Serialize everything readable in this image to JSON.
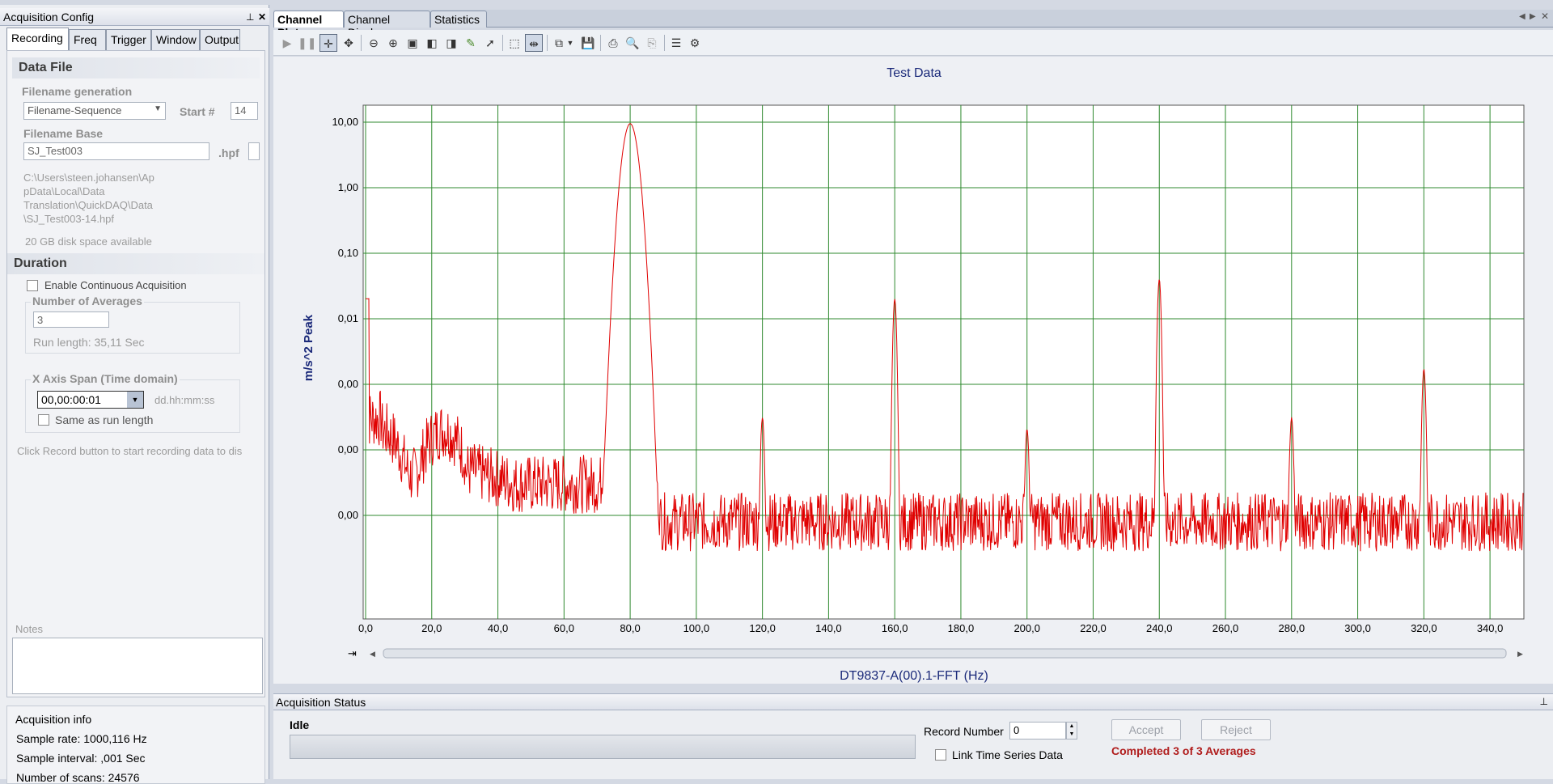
{
  "left_panel": {
    "title": "Acquisition Config",
    "pin_icon": "pin-icon",
    "close_icon": "close-icon",
    "tabs": [
      {
        "label": "Recording",
        "active": true
      },
      {
        "label": "Freq",
        "active": false
      },
      {
        "label": "Trigger",
        "active": false
      },
      {
        "label": "Window",
        "active": false
      },
      {
        "label": "Output",
        "active": false
      }
    ],
    "data_file": {
      "header": "Data File",
      "filename_generation_label": "Filename generation",
      "filename_generation_value": "Filename-Sequence",
      "start_label": "Start #",
      "start_value": "14",
      "filename_base_label": "Filename Base",
      "filename_base_value": "SJ_Test003",
      "extension": ".hpf",
      "path_lines": [
        "C:\\Users\\steen.johansen\\Ap",
        "pData\\Local\\Data",
        "Translation\\QuickDAQ\\Data",
        "\\SJ_Test003-14.hpf"
      ],
      "disk_space": "20 GB disk space available"
    },
    "duration": {
      "header": "Duration",
      "continuous_label": "Enable Continuous Acquisition",
      "averages_group": "Number of Averages",
      "averages_value": "3",
      "run_length": "Run length: 35,11 Sec",
      "span_group": "X Axis Span (Time domain)",
      "span_value": "00,00:00:01",
      "span_format": "dd.hh:mm:ss",
      "same_as_run": "Same as run length",
      "hint": "Click Record button to start recording data to dis"
    },
    "notes_label": "Notes",
    "acq_info": {
      "title": "Acquisition info",
      "sample_rate": "Sample rate: 1000,116 Hz",
      "sample_interval": "Sample interval: ,001 Sec",
      "num_scans": "Number of scans: 24576"
    }
  },
  "doc_tabs": [
    {
      "label": "Channel Plot",
      "active": true
    },
    {
      "label": "Channel Display",
      "active": false
    },
    {
      "label": "Statistics",
      "active": false
    }
  ],
  "toolbar_icons": [
    "play-icon",
    "pause-icon",
    "crosshair-icon",
    "pan-icon",
    "zoom-out-icon",
    "zoom-in-icon",
    "zoom-fit-icon",
    "zoom-x-icon",
    "zoom-y-icon",
    "cursor-icon",
    "pointer-icon",
    "select-rect-icon",
    "split-icon",
    "copy-icon",
    "dropdown-icon",
    "save-icon",
    "print-icon",
    "print-preview-icon",
    "print-setup-icon",
    "legend-icon",
    "settings-icon"
  ],
  "status": {
    "title": "Acquisition Status",
    "state": "Idle",
    "record_number_label": "Record Number",
    "record_number_value": "0",
    "accept_label": "Accept",
    "reject_label": "Reject",
    "link_label": "Link Time Series Data",
    "completed": "Completed 3 of 3 Averages"
  },
  "chart_data": {
    "type": "line",
    "title": "Test Data",
    "xlabel": "DT9837-A(00).1-FFT (Hz)",
    "ylabel": "m/s^2 Peak",
    "xlim": [
      0,
      350
    ],
    "x_ticks": [
      "0,0",
      "20,0",
      "40,0",
      "60,0",
      "80,0",
      "100,0",
      "120,0",
      "140,0",
      "160,0",
      "180,0",
      "200,0",
      "220,0",
      "240,0",
      "260,0",
      "280,0",
      "300,0",
      "320,0",
      "340,0"
    ],
    "y_scale": "log",
    "y_ticks": [
      "10,00",
      "1,00",
      "0,10",
      "0,01",
      "0,00",
      "0,00",
      "0,00"
    ],
    "grid": true,
    "line_color": "#e00000",
    "grid_color": "#2f8a2f",
    "peaks": [
      {
        "x": 80,
        "y": 9.5
      },
      {
        "x": 160,
        "y": 0.02
      },
      {
        "x": 240,
        "y": 0.04
      },
      {
        "x": 320,
        "y": 0.0017
      },
      {
        "x": 120,
        "y": 0.0003
      },
      {
        "x": 200,
        "y": 0.0002
      },
      {
        "x": 280,
        "y": 0.0003
      }
    ]
  }
}
